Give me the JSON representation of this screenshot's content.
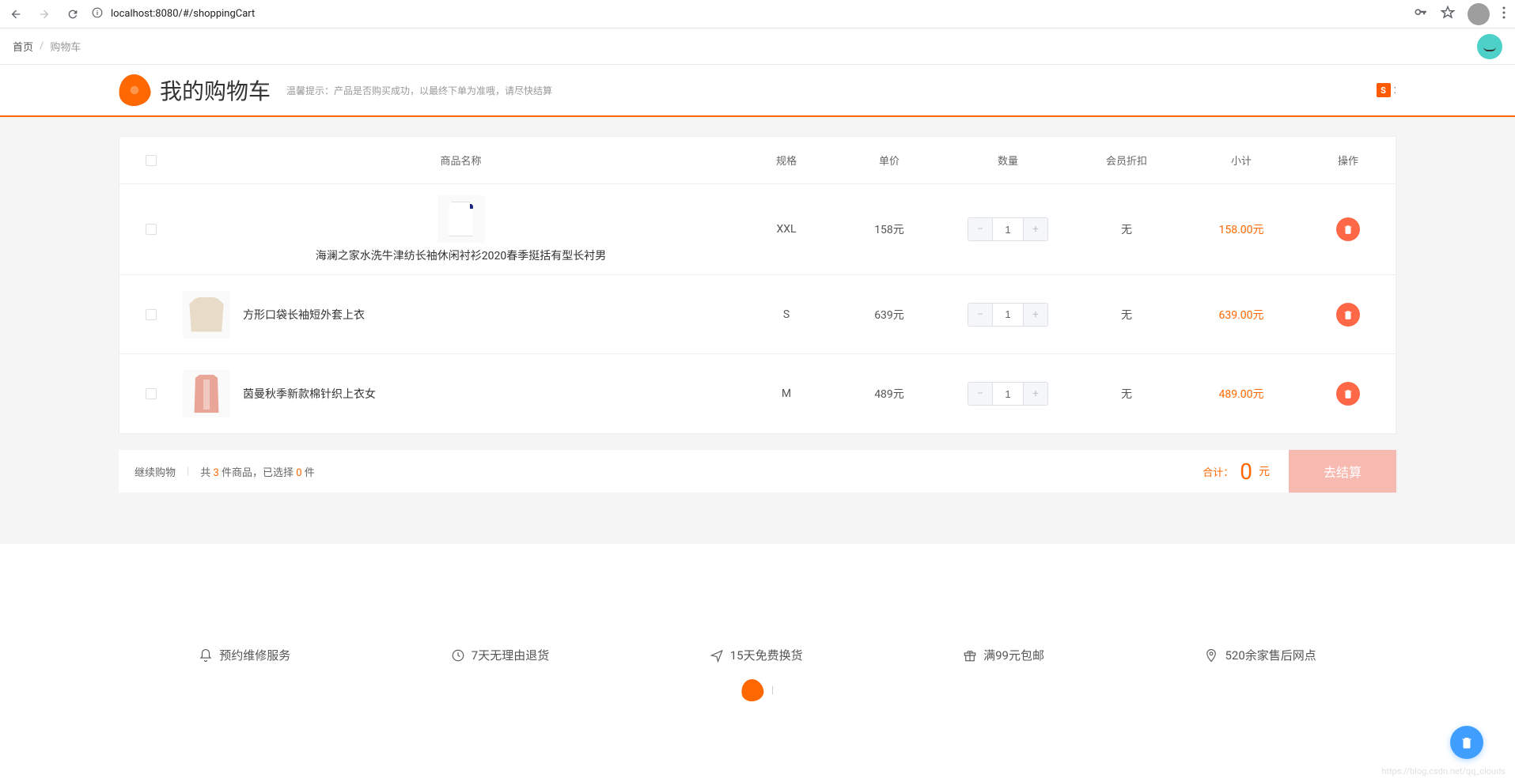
{
  "browser": {
    "url": "localhost:8080/#/shoppingCart"
  },
  "breadcrumb": {
    "home": "首页",
    "current": "购物车"
  },
  "header": {
    "title": "我的购物车",
    "tip": "温馨提示：产品是否购买成功，以最终下单为准哦，请尽快结算"
  },
  "columns": {
    "name": "商品名称",
    "spec": "规格",
    "price": "单价",
    "qty": "数量",
    "discount": "会员折扣",
    "subtotal": "小计",
    "action": "操作"
  },
  "items": [
    {
      "name": "海澜之家水洗牛津纺长袖休闲衬衫2020春季挺括有型长衬男",
      "spec": "XXL",
      "price": "158元",
      "qty": "1",
      "discount": "无",
      "subtotal": "158.00元",
      "imgClass": "shirt-white",
      "stacked": true
    },
    {
      "name": "方形口袋长袖短外套上衣",
      "spec": "S",
      "price": "639元",
      "qty": "1",
      "discount": "无",
      "subtotal": "639.00元",
      "imgClass": "jacket-beige",
      "stacked": false
    },
    {
      "name": "茵曼秋季新款棉针织上衣女",
      "spec": "M",
      "price": "489元",
      "qty": "1",
      "discount": "无",
      "subtotal": "489.00元",
      "imgClass": "cardigan-pink",
      "stacked": false
    }
  ],
  "summary": {
    "continue": "继续购物",
    "total_prefix": "共 ",
    "total_count": "3",
    "total_mid": " 件商品，已选择 ",
    "selected_count": "0",
    "total_suffix": " 件",
    "total_label": "合计：",
    "amount": "0",
    "unit": "元",
    "checkout": "去结算"
  },
  "features": [
    {
      "icon": "bell",
      "text": "预约维修服务"
    },
    {
      "icon": "clock",
      "text": "7天无理由退货"
    },
    {
      "icon": "plane",
      "text": "15天免费换货"
    },
    {
      "icon": "gift",
      "text": "满99元包邮"
    },
    {
      "icon": "pin",
      "text": "520余家售后网点"
    }
  ],
  "footer": {
    "brandTail": "|",
    "watermark": "https://blog.csdn.net/qq_clouds"
  }
}
